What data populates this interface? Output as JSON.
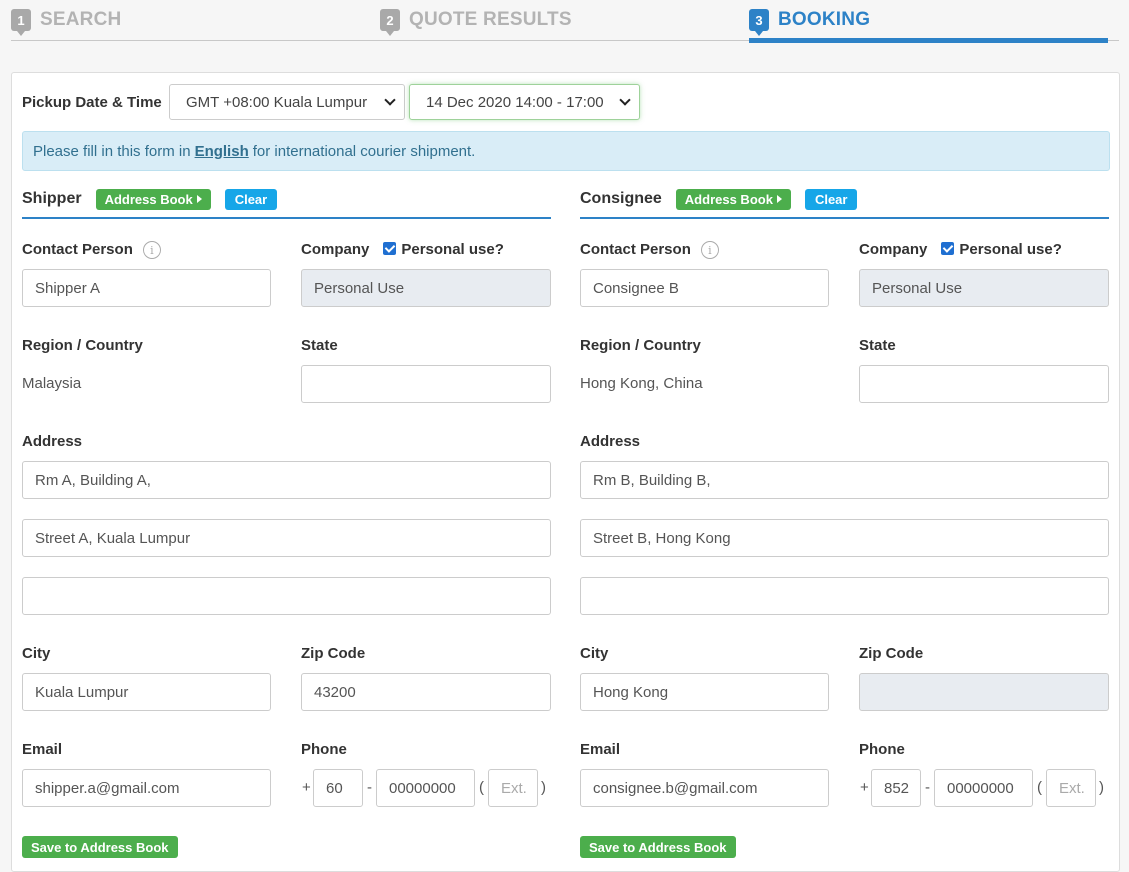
{
  "steps": [
    {
      "num": "1",
      "label": "SEARCH"
    },
    {
      "num": "2",
      "label": "QUOTE RESULTS"
    },
    {
      "num": "3",
      "label": "BOOKING"
    }
  ],
  "pickup": {
    "label": "Pickup Date & Time",
    "timezone": "GMT +08:00 Kuala Lumpur",
    "date": "14 Dec 2020 14:00 - 17:00"
  },
  "notice": {
    "before": "Please fill in this form in",
    "emphasis": "English",
    "after": "for international courier shipment."
  },
  "labels": {
    "address_book": "Address Book",
    "clear": "Clear",
    "contact_person": "Contact Person",
    "company": "Company",
    "personal_use": "Personal use?",
    "region": "Region / Country",
    "state": "State",
    "address": "Address",
    "city": "City",
    "zip": "Zip Code",
    "email": "Email",
    "phone": "Phone",
    "ext_placeholder": "Ext.",
    "save": "Save to Address Book",
    "plus": "+",
    "dash": "-",
    "paren_open": "(",
    "paren_close": ")"
  },
  "shipper": {
    "title": "Shipper",
    "contact": "Shipper A",
    "company": "Personal Use",
    "region": "Malaysia",
    "state": "",
    "address1": "Rm A, Building A,",
    "address2": "Street A, Kuala Lumpur",
    "address3": "",
    "city": "Kuala Lumpur",
    "zip": "43200",
    "email": "shipper.a@gmail.com",
    "phone_code": "60",
    "phone_number": "00000000"
  },
  "consignee": {
    "title": "Consignee",
    "contact": "Consignee B",
    "company": "Personal Use",
    "region": "Hong Kong, China",
    "state": "",
    "address1": "Rm B, Building B,",
    "address2": "Street B, Hong Kong",
    "address3": "",
    "city": "Hong Kong",
    "zip": "",
    "email": "consignee.b@gmail.com",
    "phone_code": "852",
    "phone_number": "00000000"
  },
  "colors": {
    "primary": "#2d82c7",
    "green": "#4cae4c",
    "blue_button": "#16a6e8",
    "notice_bg": "#d9edf7"
  }
}
